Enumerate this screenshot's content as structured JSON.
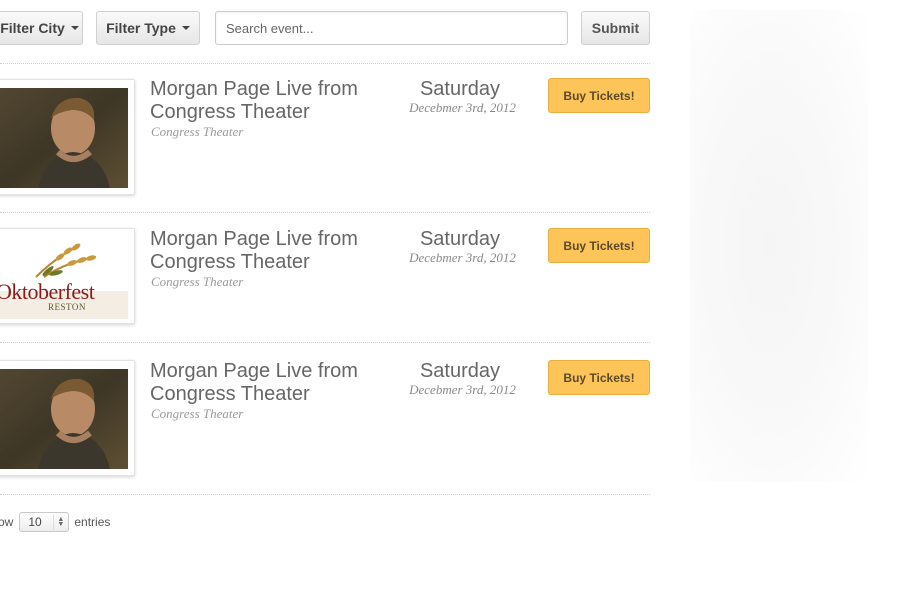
{
  "filters": {
    "city_label": "Filter City",
    "type_label": "Filter Type",
    "search_placeholder": "Search event...",
    "search_value": "",
    "submit_label": "Submit"
  },
  "events": [
    {
      "image": "artist-photo",
      "title": "Morgan Page Live from Congress Theater",
      "venue": "Congress Theater",
      "day": "Saturday",
      "date": "Decebmer 3rd, 2012",
      "button_label": "Buy Tickets!"
    },
    {
      "image": "oktoberfest-logo",
      "logo_text": "Oktoberfest",
      "logo_subtext": "RESTON",
      "title": "Morgan Page Live from Congress Theater",
      "venue": "Congress Theater",
      "day": "Saturday",
      "date": "Decebmer 3rd, 2012",
      "button_label": "Buy Tickets!"
    },
    {
      "image": "artist-photo",
      "title": "Morgan Page Live from Congress Theater",
      "venue": "Congress Theater",
      "day": "Saturday",
      "date": "Decebmer 3rd, 2012",
      "button_label": "Buy Tickets!"
    }
  ],
  "footer": {
    "show_prefix": "ow",
    "entries_value": "10",
    "entries_suffix": "entries"
  },
  "colors": {
    "buy_button": "#fdc45a",
    "oktoberfest_red": "#8b1a1a",
    "wheat": "#b8862e"
  }
}
